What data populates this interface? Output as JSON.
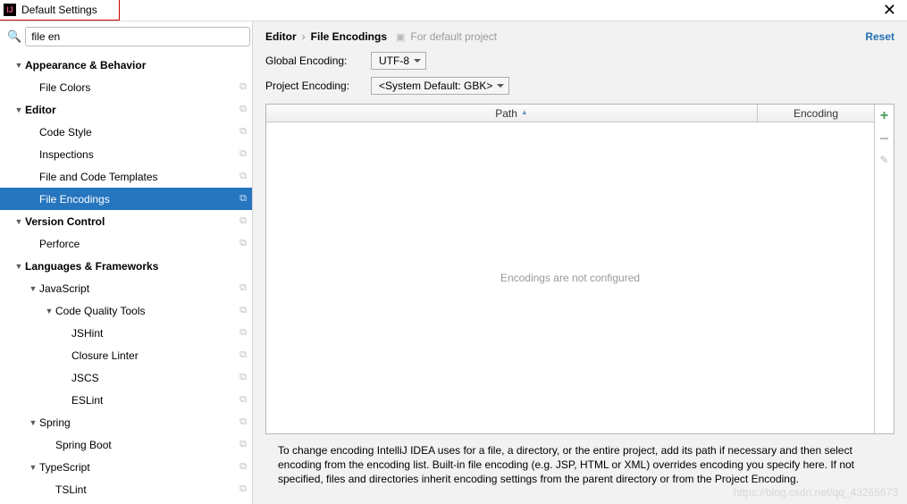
{
  "window_title": "Default Settings",
  "search": {
    "value": "file en"
  },
  "tree": [
    {
      "label": "Appearance & Behavior",
      "bold": true,
      "arrow": "down",
      "ind": 0,
      "copy": false
    },
    {
      "label": "File Colors",
      "bold": false,
      "arrow": "",
      "ind": 1,
      "copy": true
    },
    {
      "label": "Editor",
      "bold": true,
      "arrow": "down",
      "ind": 0,
      "copy": true
    },
    {
      "label": "Code Style",
      "bold": false,
      "arrow": "",
      "ind": 1,
      "copy": true
    },
    {
      "label": "Inspections",
      "bold": false,
      "arrow": "",
      "ind": 1,
      "copy": true
    },
    {
      "label": "File and Code Templates",
      "bold": false,
      "arrow": "",
      "ind": 1,
      "copy": true
    },
    {
      "label": "File Encodings",
      "bold": false,
      "arrow": "",
      "ind": 1,
      "copy": true,
      "sel": true
    },
    {
      "label": "Version Control",
      "bold": true,
      "arrow": "down",
      "ind": 0,
      "copy": true
    },
    {
      "label": "Perforce",
      "bold": false,
      "arrow": "",
      "ind": 1,
      "copy": true
    },
    {
      "label": "Languages & Frameworks",
      "bold": true,
      "arrow": "down",
      "ind": 0,
      "copy": false
    },
    {
      "label": "JavaScript",
      "bold": false,
      "arrow": "down",
      "ind": 1,
      "copy": true
    },
    {
      "label": "Code Quality Tools",
      "bold": false,
      "arrow": "down",
      "ind": 2,
      "copy": true
    },
    {
      "label": "JSHint",
      "bold": false,
      "arrow": "",
      "ind": 3,
      "copy": true
    },
    {
      "label": "Closure Linter",
      "bold": false,
      "arrow": "",
      "ind": 3,
      "copy": true
    },
    {
      "label": "JSCS",
      "bold": false,
      "arrow": "",
      "ind": 3,
      "copy": true
    },
    {
      "label": "ESLint",
      "bold": false,
      "arrow": "",
      "ind": 3,
      "copy": true
    },
    {
      "label": "Spring",
      "bold": false,
      "arrow": "down",
      "ind": 1,
      "copy": true
    },
    {
      "label": "Spring Boot",
      "bold": false,
      "arrow": "",
      "ind": 2,
      "copy": true
    },
    {
      "label": "TypeScript",
      "bold": false,
      "arrow": "down",
      "ind": 1,
      "copy": true
    },
    {
      "label": "TSLint",
      "bold": false,
      "arrow": "",
      "ind": 2,
      "copy": true
    }
  ],
  "breadcrumb": {
    "part1": "Editor",
    "part2": "File Encodings",
    "hint": "For default project"
  },
  "reset_label": "Reset",
  "global_encoding": {
    "label": "Global Encoding:",
    "value": "UTF-8"
  },
  "project_encoding": {
    "label": "Project Encoding:",
    "value": "<System Default: GBK>"
  },
  "table": {
    "col_path": "Path",
    "col_encoding": "Encoding",
    "empty": "Encodings are not configured"
  },
  "help_text": "To change encoding IntelliJ IDEA uses for a file, a directory, or the entire project, add its path if necessary and then select encoding from the encoding list. Built-in file encoding (e.g. JSP, HTML or XML) overrides encoding you specify here. If not specified, files and directories inherit encoding settings from the parent directory or from the Project Encoding.",
  "watermark": "https://blog.csdn.net/qq_43265673"
}
